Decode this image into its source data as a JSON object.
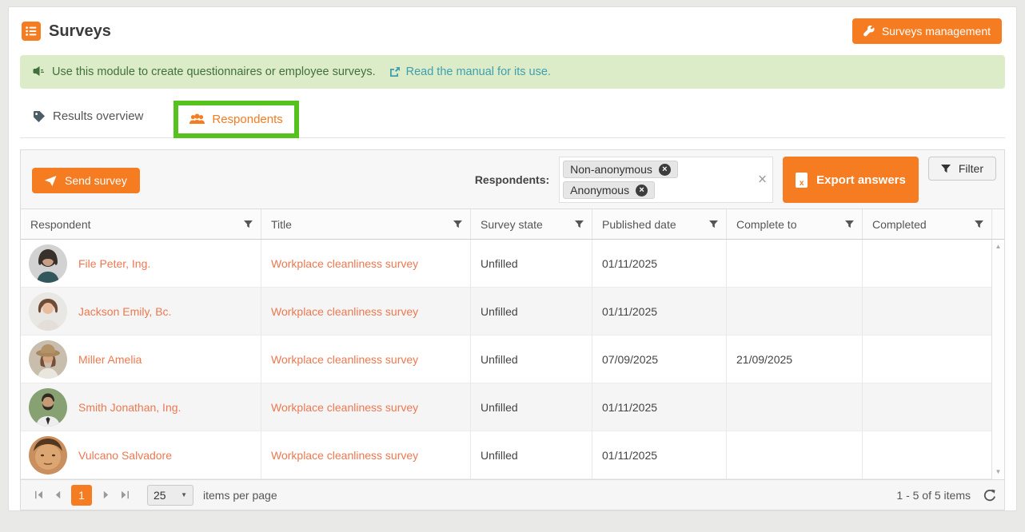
{
  "colors": {
    "accent": "#f57c21",
    "link_orange": "#ee7850",
    "highlight_green": "#56c21d",
    "banner_bg": "#dcecc8",
    "banner_text": "#41703c",
    "manual_link": "#3f9fae"
  },
  "header": {
    "title": "Surveys",
    "management_button": "Surveys management"
  },
  "banner": {
    "text": "Use this module to create questionnaires or employee surveys.",
    "link_text": "Read the manual for its use."
  },
  "tabs": [
    {
      "label": "Results overview"
    },
    {
      "label": "Respondents"
    }
  ],
  "toolbar": {
    "send_button": "Send survey",
    "respondents_label": "Respondents:",
    "tags": [
      "Non-anonymous",
      "Anonymous"
    ],
    "export_button": "Export answers",
    "filter_button": "Filter"
  },
  "table": {
    "columns": [
      {
        "label": "Respondent"
      },
      {
        "label": "Title"
      },
      {
        "label": "Survey state"
      },
      {
        "label": "Published date"
      },
      {
        "label": "Complete to"
      },
      {
        "label": "Completed"
      }
    ],
    "rows": [
      {
        "respondent": "File Peter, Ing.",
        "title": "Workplace cleanliness survey",
        "state": "Unfilled",
        "published": "01/11/2025",
        "complete_to": "",
        "completed": ""
      },
      {
        "respondent": "Jackson Emily, Bc.",
        "title": "Workplace cleanliness survey",
        "state": "Unfilled",
        "published": "01/11/2025",
        "complete_to": "",
        "completed": ""
      },
      {
        "respondent": "Miller Amelia",
        "title": "Workplace cleanliness survey",
        "state": "Unfilled",
        "published": "07/09/2025",
        "complete_to": "21/09/2025",
        "completed": ""
      },
      {
        "respondent": "Smith Jonathan, Ing.",
        "title": "Workplace cleanliness survey",
        "state": "Unfilled",
        "published": "01/11/2025",
        "complete_to": "",
        "completed": ""
      },
      {
        "respondent": "Vulcano Salvadore",
        "title": "Workplace cleanliness survey",
        "state": "Unfilled",
        "published": "01/11/2025",
        "complete_to": "",
        "completed": ""
      }
    ]
  },
  "pagination": {
    "current_page": "1",
    "page_size": "25",
    "items_per_page_label": "items per page",
    "range_label": "1 - 5 of 5 items"
  },
  "icons": {
    "surveys-icon": "orange list tile",
    "wrench-icon": "wrench",
    "megaphone-icon": "megaphone",
    "external-link-icon": "box with arrow",
    "tag-icon": "label tag",
    "people-icon": "user group",
    "send-icon": "paper plane",
    "excel-icon": "spreadsheet file",
    "filter-icon": "funnel",
    "remove-icon": "circled x",
    "clear-icon": "x",
    "pager-first-icon": "bar + left caret",
    "pager-prev-icon": "left caret",
    "pager-next-icon": "right caret",
    "pager-last-icon": "right caret + bar",
    "dropdown-caret-icon": "down caret",
    "scroll-up-icon": "up triangle",
    "scroll-down-icon": "down triangle",
    "refresh-icon": "circular arrow"
  }
}
